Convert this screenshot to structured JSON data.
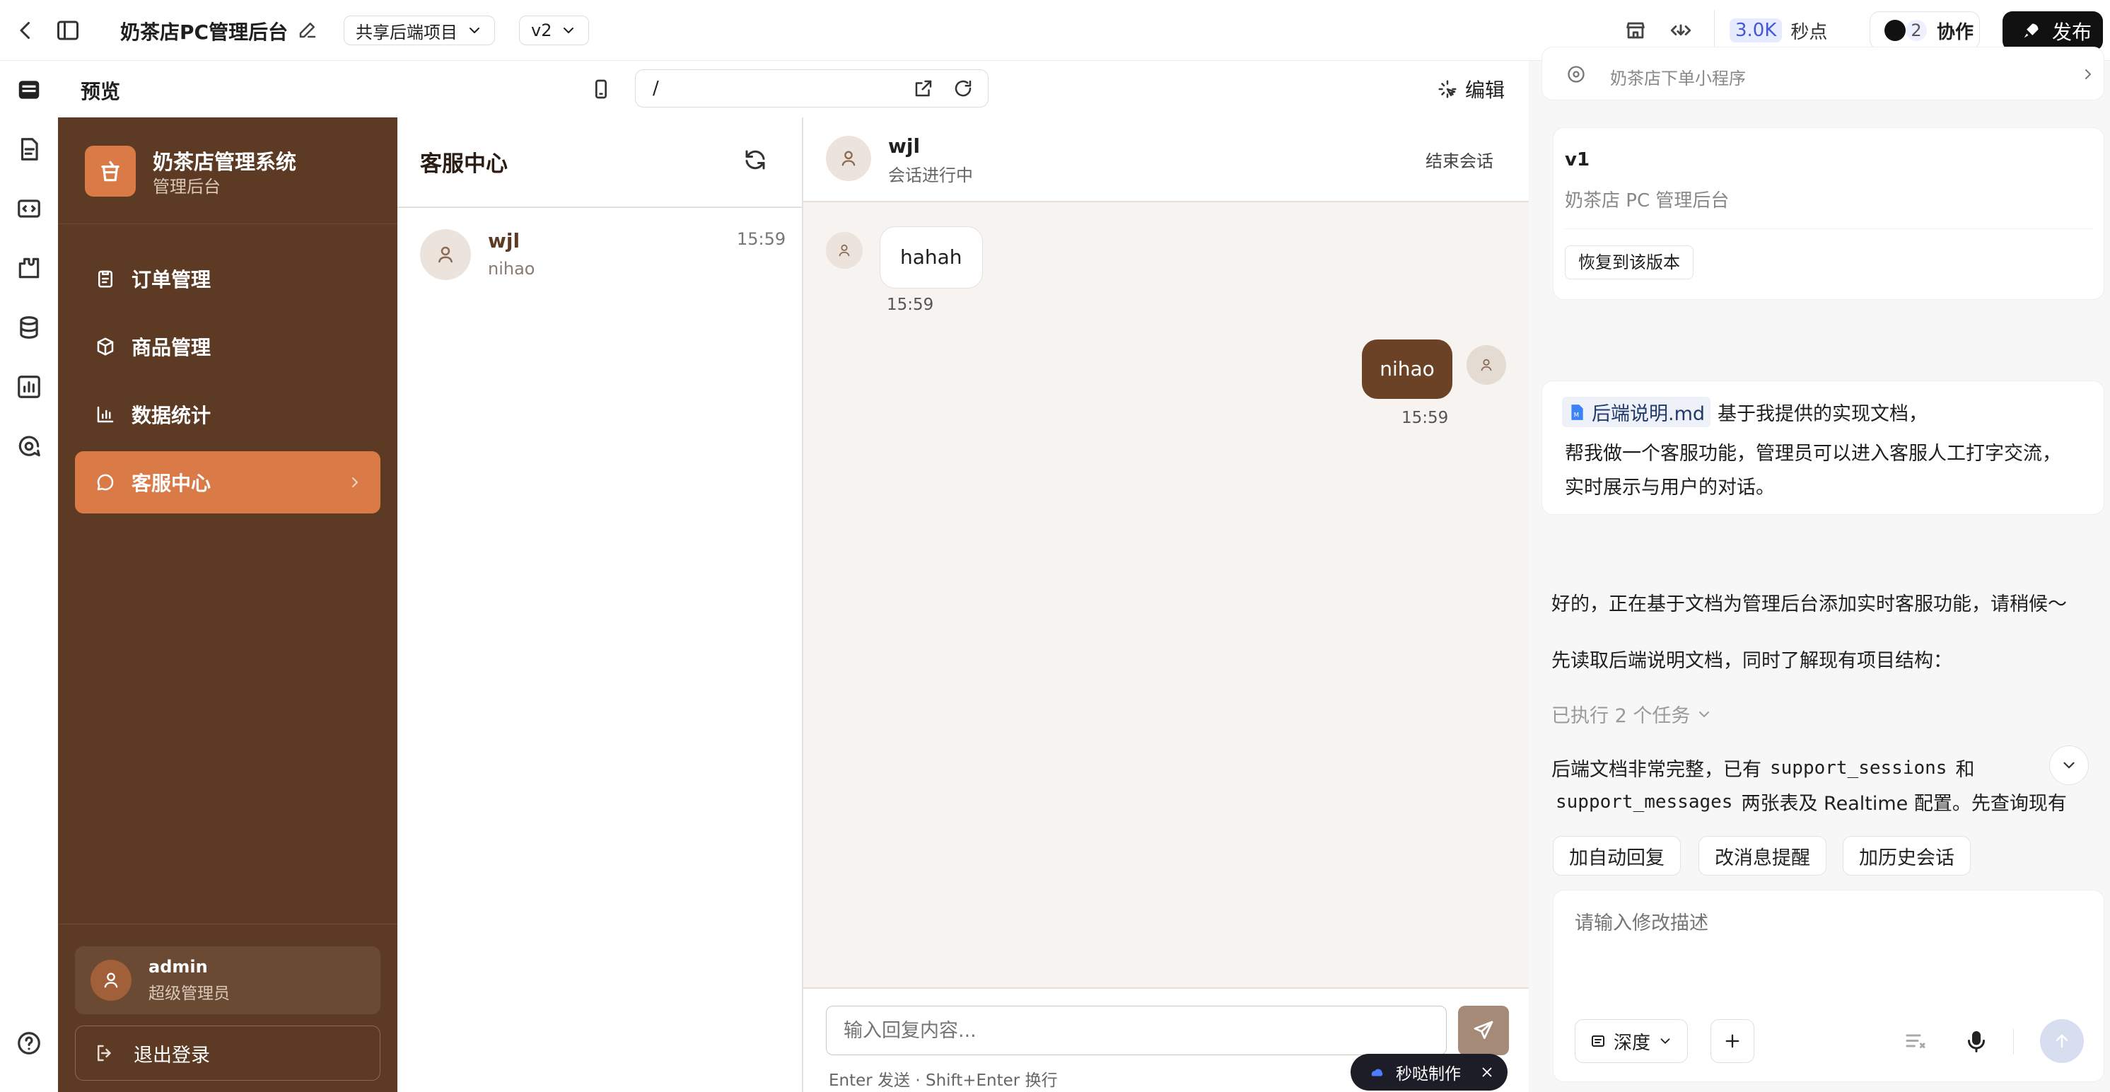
{
  "topbar": {
    "project_title": "奶茶店PC管理后台",
    "backend_dropdown": "共享后端项目",
    "version_dropdown": "v2",
    "credits_value": "3.0K",
    "credits_unit": "秒点",
    "collab_count": "2",
    "collab_label": "协作",
    "publish_label": "发布"
  },
  "preview": {
    "label": "预览",
    "url": "/",
    "edit_label": "编辑"
  },
  "app": {
    "brand_title": "奶茶店管理系统",
    "brand_subtitle": "管理后台",
    "nav": [
      {
        "label": "订单管理",
        "icon": "clipboard-icon"
      },
      {
        "label": "商品管理",
        "icon": "box-icon"
      },
      {
        "label": "数据统计",
        "icon": "bar-chart-icon"
      },
      {
        "label": "客服中心",
        "icon": "chat-bubble-icon"
      }
    ],
    "user_name": "admin",
    "user_role": "超级管理员",
    "logout_label": "退出登录"
  },
  "conversations": {
    "title": "客服中心",
    "items": [
      {
        "name": "wjl",
        "preview": "nihao",
        "time": "15:59"
      }
    ]
  },
  "chat": {
    "user_name": "wjl",
    "status": "会话进行中",
    "end_label": "结束会话",
    "messages": [
      {
        "from": "user",
        "text": "hahah",
        "time": "15:59"
      },
      {
        "from": "admin",
        "text": "nihao",
        "time": "15:59"
      }
    ],
    "input_placeholder": "输入回复内容...",
    "hint": "Enter 发送 · Shift+Enter 换行",
    "badge_label": "秒哒制作"
  },
  "ai": {
    "top_card_text": "奶茶店下单小程序",
    "version_card": {
      "version": "v1",
      "description": "奶茶店 PC 管理后台",
      "restore_label": "恢复到该版本"
    },
    "user_msg": {
      "file_name": "后端说明.md",
      "line1": "基于我提供的实现文档，",
      "line2": "帮我做一个客服功能，管理员可以进入客服人工打字交流，",
      "line3": "实时展示与用户的对话。"
    },
    "reply1": "好的，正在基于文档为管理后台添加实时客服功能，请稍候～",
    "reply2": "先读取后端说明文档，同时了解现有项目结构：",
    "tasks_label": "已执行 2 个任务",
    "reply3_a": "后端文档非常完整，已有",
    "reply3_code1": "support_sessions",
    "reply3_b": "和",
    "reply3_code2": "support_messages",
    "reply3_c": "两张表及 Realtime 配置。先查询现有",
    "suggestions": [
      "加自动回复",
      "改消息提醒",
      "加历史会话"
    ],
    "input_placeholder": "请输入修改描述",
    "depth_label": "深度"
  },
  "colors": {
    "sidebar_bg": "#5c3a24",
    "accent": "#d97a47",
    "admin_bubble": "#6b4226",
    "chat_bg": "#f6f3f0"
  }
}
